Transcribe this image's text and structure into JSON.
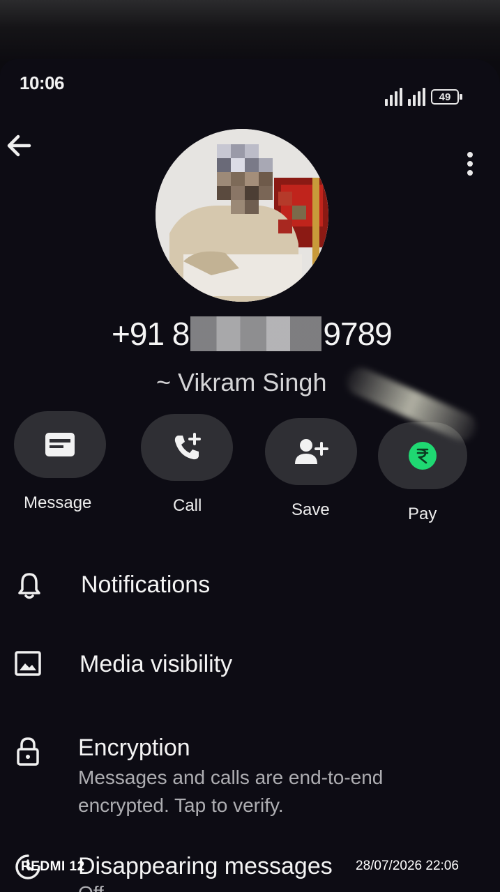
{
  "status_bar": {
    "time": "10:06",
    "battery": "49"
  },
  "profile": {
    "phone_prefix": "+91 8",
    "phone_suffix": "9789",
    "name": "~ Vikram Singh"
  },
  "actions": [
    {
      "label": "Message",
      "icon": "message-icon"
    },
    {
      "label": "Call",
      "icon": "add-call-icon"
    },
    {
      "label": "Save",
      "icon": "add-contact-icon"
    },
    {
      "label": "Pay",
      "icon": "rupee-icon"
    }
  ],
  "menu": {
    "notifications": {
      "title": "Notifications",
      "icon": "bell-icon"
    },
    "media_visibility": {
      "title": "Media visibility",
      "icon": "image-icon"
    },
    "encryption": {
      "title": "Encryption",
      "subtitle": "Messages and calls are end-to-end encrypted. Tap to verify.",
      "icon": "lock-icon"
    },
    "disappearing": {
      "title": "Disappearing messages",
      "subtitle": "Off",
      "icon": "timer-icon"
    }
  },
  "watermark": {
    "device": "REDMI 12",
    "datetime": "28/07/2026 22:06"
  },
  "colors": {
    "background": "#0d0c14",
    "button_bg": "#2f2f34",
    "pay_green": "#1fd872",
    "text_primary": "#f4f4f4",
    "text_secondary": "#aeaeb2"
  }
}
